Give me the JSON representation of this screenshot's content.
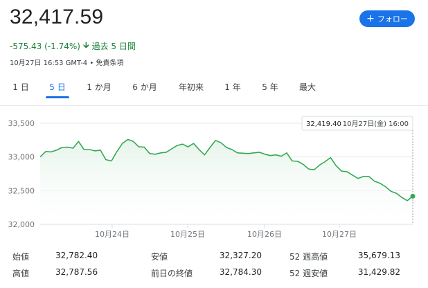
{
  "header": {
    "price": "32,417.59",
    "follow_label": "フォロー",
    "change": "-575.43 (-1.74%)",
    "period": "過去 5 日間",
    "meta": "10月27日 16:53 GMT-4 • 免責条項"
  },
  "tabs": [
    {
      "label": "1 日",
      "active": false
    },
    {
      "label": "5 日",
      "active": true
    },
    {
      "label": "1 か月",
      "active": false
    },
    {
      "label": "6 か月",
      "active": false
    },
    {
      "label": "年初来",
      "active": false
    },
    {
      "label": "1 年",
      "active": false
    },
    {
      "label": "5 年",
      "active": false
    },
    {
      "label": "最大",
      "active": false
    }
  ],
  "chart_data": {
    "type": "area",
    "yticks": [
      "33,500",
      "33,000",
      "32,500",
      "32,000"
    ],
    "ylim": [
      32000,
      33500
    ],
    "xticks": [
      "10月24日",
      "10月25日",
      "10月26日",
      "10月27日"
    ],
    "tooltip": {
      "value": "32,419.40",
      "time": "10月27日(金) 16:00"
    },
    "colors": {
      "line": "#34a853",
      "fill": "#e6f4ea"
    },
    "values": [
      33000,
      33080,
      33075,
      33100,
      33140,
      33145,
      33130,
      33230,
      33110,
      33110,
      33090,
      33100,
      32960,
      32940,
      33080,
      33200,
      33260,
      33230,
      33150,
      33145,
      33050,
      33040,
      33060,
      33070,
      33120,
      33170,
      33190,
      33150,
      33200,
      33110,
      33030,
      33140,
      33245,
      33210,
      33140,
      33110,
      33060,
      33055,
      33050,
      33060,
      33070,
      33040,
      33020,
      33030,
      33010,
      33060,
      32940,
      32935,
      32890,
      32820,
      32810,
      32880,
      32930,
      32990,
      32870,
      32790,
      32780,
      32730,
      32680,
      32710,
      32710,
      32640,
      32610,
      32560,
      32490,
      32460,
      32400,
      32350,
      32417
    ]
  },
  "stats": [
    {
      "label": "始値",
      "value": "32,782.40"
    },
    {
      "label": "安値",
      "value": "32,327.20"
    },
    {
      "label": "52 週高値",
      "value": "35,679.13"
    },
    {
      "label": "高値",
      "value": "32,787.56"
    },
    {
      "label": "前日の終値",
      "value": "32,784.30"
    },
    {
      "label": "52 週安値",
      "value": "31,429.82"
    }
  ]
}
